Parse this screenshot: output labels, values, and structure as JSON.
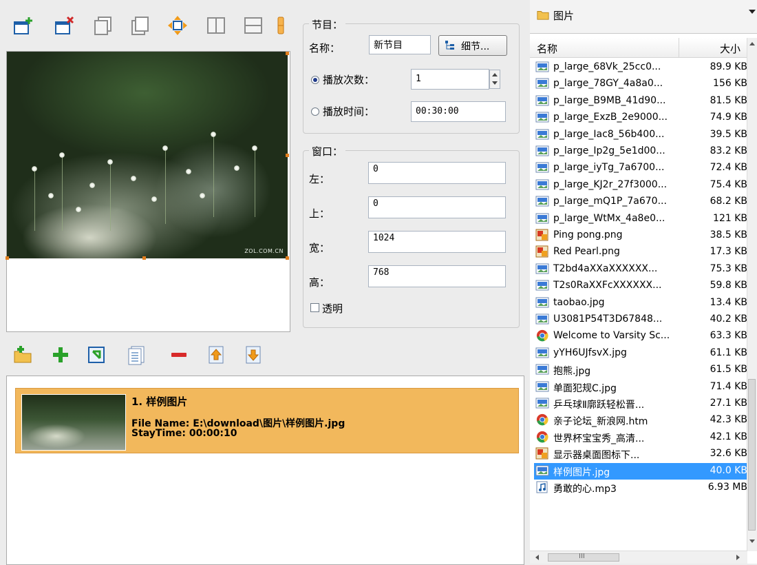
{
  "program_group": {
    "title": "节目：",
    "name_label": "名称：",
    "name_value": "新节目",
    "detail_button": "细节...",
    "play_count_label": "播放次数：",
    "play_count_value": "1",
    "play_time_label": "播放时间：",
    "play_time_value": "00:30:00",
    "selected_mode": "play_count"
  },
  "window_group": {
    "title": "窗口：",
    "left_label": "左：",
    "left_value": "0",
    "top_label": "上：",
    "top_value": "0",
    "width_label": "宽：",
    "width_value": "1024",
    "height_label": "高：",
    "height_value": "768",
    "transparent_label": "透明",
    "transparent_checked": false
  },
  "preview": {
    "watermark": "ZOL.COM.CN"
  },
  "playlist": {
    "items": [
      {
        "title": "1. 样例图片",
        "file_name_line": "File Name: E:\\download\\图片\\样例图片.jpg",
        "stay_time_line": "StayTime: 00:00:10"
      }
    ]
  },
  "file_browser": {
    "folder": "图片",
    "col_name": "名称",
    "col_size": "大小",
    "hscroll_grip": "III",
    "files": [
      {
        "name": "p_large_68Vk_25cc0...",
        "size": "89.9 KB",
        "icon": "image-file-icon"
      },
      {
        "name": "p_large_78GY_4a8a0...",
        "size": "156 KB",
        "icon": "image-file-icon"
      },
      {
        "name": "p_large_B9MB_41d90...",
        "size": "81.5 KB",
        "icon": "image-file-icon"
      },
      {
        "name": "p_large_ExzB_2e9000...",
        "size": "74.9 KB",
        "icon": "image-file-icon"
      },
      {
        "name": "p_large_Iac8_56b400...",
        "size": "39.5 KB",
        "icon": "image-file-icon"
      },
      {
        "name": "p_large_Ip2g_5e1d00...",
        "size": "83.2 KB",
        "icon": "image-file-icon"
      },
      {
        "name": "p_large_iyTg_7a6700...",
        "size": "72.4 KB",
        "icon": "image-file-icon"
      },
      {
        "name": "p_large_KJ2r_27f3000...",
        "size": "75.4 KB",
        "icon": "image-file-icon"
      },
      {
        "name": "p_large_mQ1P_7a670...",
        "size": "68.2 KB",
        "icon": "image-file-icon"
      },
      {
        "name": "p_large_WtMx_4a8e0...",
        "size": "121 KB",
        "icon": "image-file-icon"
      },
      {
        "name": "Ping pong.png",
        "size": "38.5 KB",
        "icon": "png-file-icon"
      },
      {
        "name": "Red Pearl.png",
        "size": "17.3 KB",
        "icon": "png-file-icon"
      },
      {
        "name": "T2bd4aXXaXXXXXX...",
        "size": "75.3 KB",
        "icon": "image-file-icon"
      },
      {
        "name": "T2s0RaXXFcXXXXXX...",
        "size": "59.8 KB",
        "icon": "image-file-icon"
      },
      {
        "name": "taobao.jpg",
        "size": "13.4 KB",
        "icon": "image-file-icon"
      },
      {
        "name": "U3081P54T3D67848...",
        "size": "40.2 KB",
        "icon": "image-file-icon"
      },
      {
        "name": "Welcome to Varsity Sc...",
        "size": "63.3 KB",
        "icon": "chrome-icon"
      },
      {
        "name": "yYH6UJfsvX.jpg",
        "size": "61.1 KB",
        "icon": "image-file-icon"
      },
      {
        "name": "抱熊.jpg",
        "size": "61.5 KB",
        "icon": "image-file-icon"
      },
      {
        "name": "单面犯规C.jpg",
        "size": "71.4 KB",
        "icon": "image-file-icon"
      },
      {
        "name": "乒乓球Ⅱ廓跃轻松晋...",
        "size": "27.1 KB",
        "icon": "image-file-icon"
      },
      {
        "name": "亲子论坛_新浪网.htm",
        "size": "42.3 KB",
        "icon": "chrome-icon"
      },
      {
        "name": "世界杯宝宝秀_高清...",
        "size": "42.1 KB",
        "icon": "chrome-icon"
      },
      {
        "name": "显示器桌面图标下...",
        "size": "32.6 KB",
        "icon": "png-file-icon"
      },
      {
        "name": "样例图片.jpg",
        "size": "40.0 KB",
        "icon": "image-file-icon",
        "selected": true
      },
      {
        "name": "勇敢的心.mp3",
        "size": "6.93 MB",
        "icon": "audio-file-icon"
      }
    ]
  }
}
